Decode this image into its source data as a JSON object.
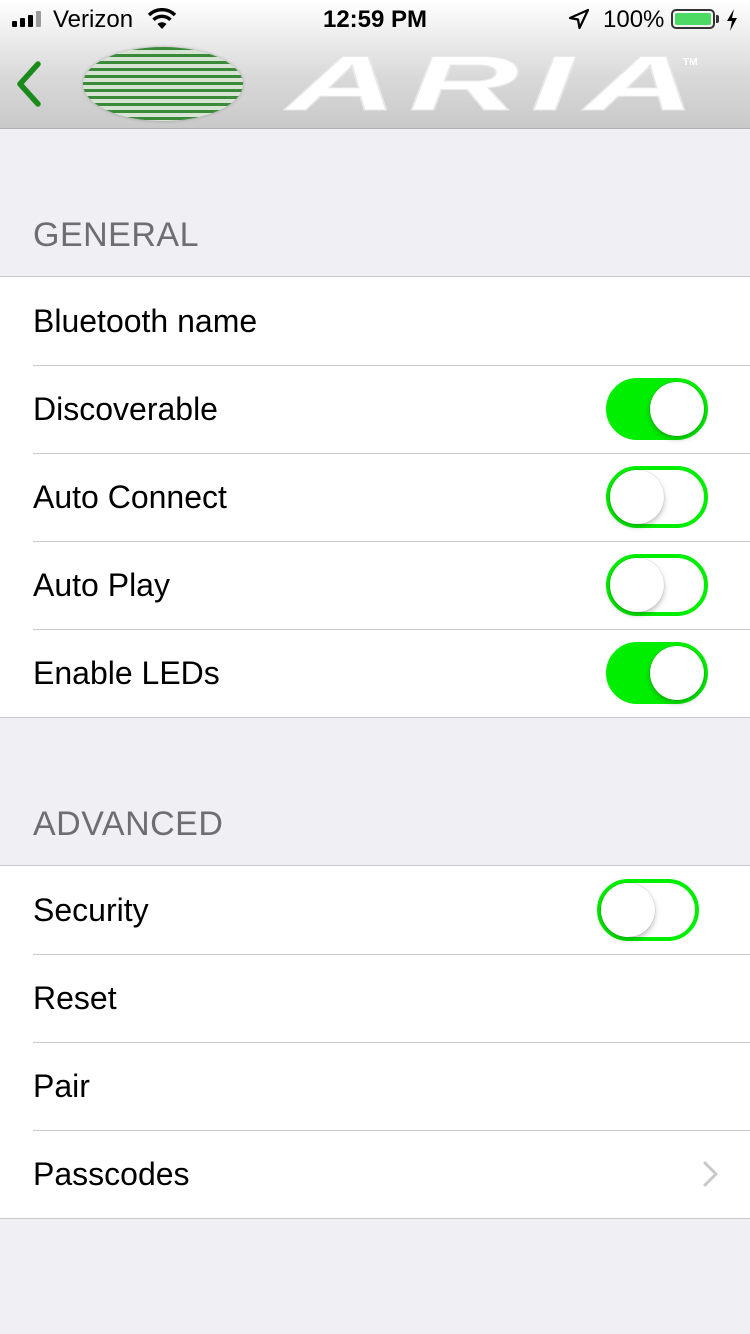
{
  "status_bar": {
    "carrier": "Verizon",
    "time": "12:59 PM",
    "battery_percent": "100%",
    "battery_level": 1.0,
    "signal_bars": 4,
    "signal_bars_active": 3
  },
  "nav": {
    "back_icon": "chevron-left-icon",
    "accent_color": "#1a8a1a",
    "logo_text": "ARIA",
    "logo_tm": "TM"
  },
  "sections": {
    "general": {
      "title": "GENERAL",
      "rows": {
        "bluetooth_name": {
          "label": "Bluetooth name"
        },
        "discoverable": {
          "label": "Discoverable",
          "on": true
        },
        "auto_connect": {
          "label": "Auto Connect",
          "on": false
        },
        "auto_play": {
          "label": "Auto Play",
          "on": false
        },
        "enable_leds": {
          "label": "Enable LEDs",
          "on": true
        }
      }
    },
    "advanced": {
      "title": "ADVANCED",
      "rows": {
        "security": {
          "label": "Security",
          "on": false
        },
        "reset": {
          "label": "Reset"
        },
        "pair": {
          "label": "Pair"
        },
        "passcodes": {
          "label": "Passcodes",
          "accessory": "chevron-right-icon"
        }
      }
    }
  },
  "colors": {
    "toggle_on": "#00ee00",
    "background": "#efeff4",
    "section_header": "#6d6d72"
  }
}
